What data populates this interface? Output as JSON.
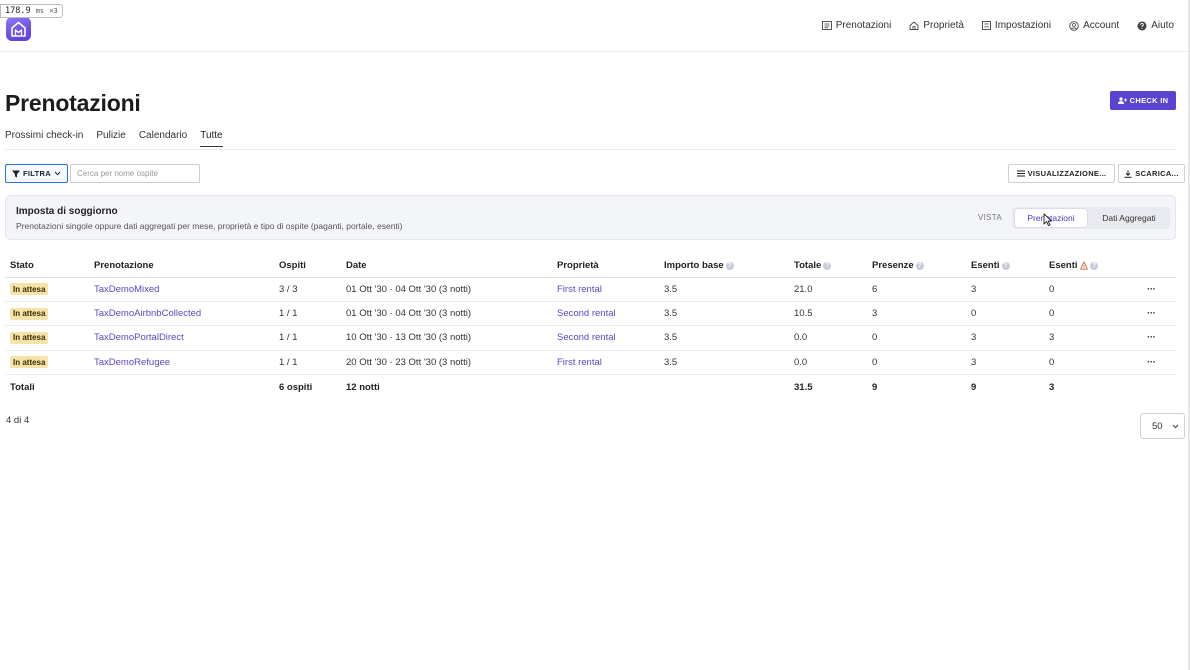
{
  "perf": {
    "value": "178.9",
    "unit": "ms",
    "count": "×3"
  },
  "nav": [
    {
      "label": "Prenotazioni",
      "icon": "list-icon"
    },
    {
      "label": "Proprietà",
      "icon": "house-icon"
    },
    {
      "label": "Impostazioni",
      "icon": "settings-list-icon"
    },
    {
      "label": "Account",
      "icon": "user-circle-icon"
    },
    {
      "label": "Aiuto",
      "icon": "help-circle-icon"
    }
  ],
  "page": {
    "title": "Prenotazioni",
    "checkin_label": "CHECK IN"
  },
  "tabs": [
    "Prossimi check-in",
    "Pulizie",
    "Calendario",
    "Tutte"
  ],
  "active_tab": "Tutte",
  "filter": {
    "label": "FILTRA",
    "search_placeholder": "Cerca per nome ospite",
    "search_value": ""
  },
  "actions": {
    "view_label": "VISUALIZZAZIONE...",
    "download_label": "SCARICA..."
  },
  "tax_panel": {
    "title": "Imposta di soggiorno",
    "subtitle": "Prenotazioni singole oppure dati aggregati per mese, proprietà e tipo di ospite (paganti, portale, esenti)",
    "vista_label": "VISTA",
    "options": [
      "Prenotazioni",
      "Dati Aggregati"
    ],
    "selected": "Prenotazioni"
  },
  "table": {
    "columns": [
      "Stato",
      "Prenotazione",
      "Ospiti",
      "Date",
      "Proprietà",
      "Importo base",
      "Totale",
      "Presenze",
      "Esenti",
      "Esenti"
    ],
    "rows": [
      {
        "status": "In attesa",
        "booking": "TaxDemoMixed",
        "guests": "3 / 3",
        "dates": "01 Ott '30 · 04 Ott '30 (3 notti)",
        "property": "First rental",
        "base": "3.5",
        "total": "21.0",
        "presences": "6",
        "exempt": "3",
        "exempt2": "0",
        "more": "···"
      },
      {
        "status": "In attesa",
        "booking": "TaxDemoAirbnbCollected",
        "guests": "1 / 1",
        "dates": "01 Ott '30 · 04 Ott '30 (3 notti)",
        "property": "Second rental",
        "base": "3.5",
        "total": "10.5",
        "presences": "3",
        "exempt": "0",
        "exempt2": "0",
        "more": "···"
      },
      {
        "status": "In attesa",
        "booking": "TaxDemoPortalDirect",
        "guests": "1 / 1",
        "dates": "10 Ott '30 · 13 Ott '30 (3 notti)",
        "property": "Second rental",
        "base": "3.5",
        "total": "0.0",
        "presences": "0",
        "exempt": "3",
        "exempt2": "3",
        "more": "···"
      },
      {
        "status": "In attesa",
        "booking": "TaxDemoRefugee",
        "guests": "1 / 1",
        "dates": "20 Ott '30 · 23 Ott '30 (3 notti)",
        "property": "First rental",
        "base": "3.5",
        "total": "0.0",
        "presences": "0",
        "exempt": "3",
        "exempt2": "0",
        "more": "···"
      }
    ],
    "totals": {
      "label": "Totali",
      "guests": "6 ospiti",
      "dates": "12 notti",
      "total": "31.5",
      "presences": "9",
      "exempt": "9",
      "exempt2": "3"
    },
    "help_glyph": "?"
  },
  "pager": {
    "count": "4 di 4",
    "page_size": "50"
  },
  "colors": {
    "accent": "#5a43d0",
    "link": "#5a48c8",
    "badge_bg": "#f6e3a8",
    "filter_border": "#2f6fd8"
  }
}
